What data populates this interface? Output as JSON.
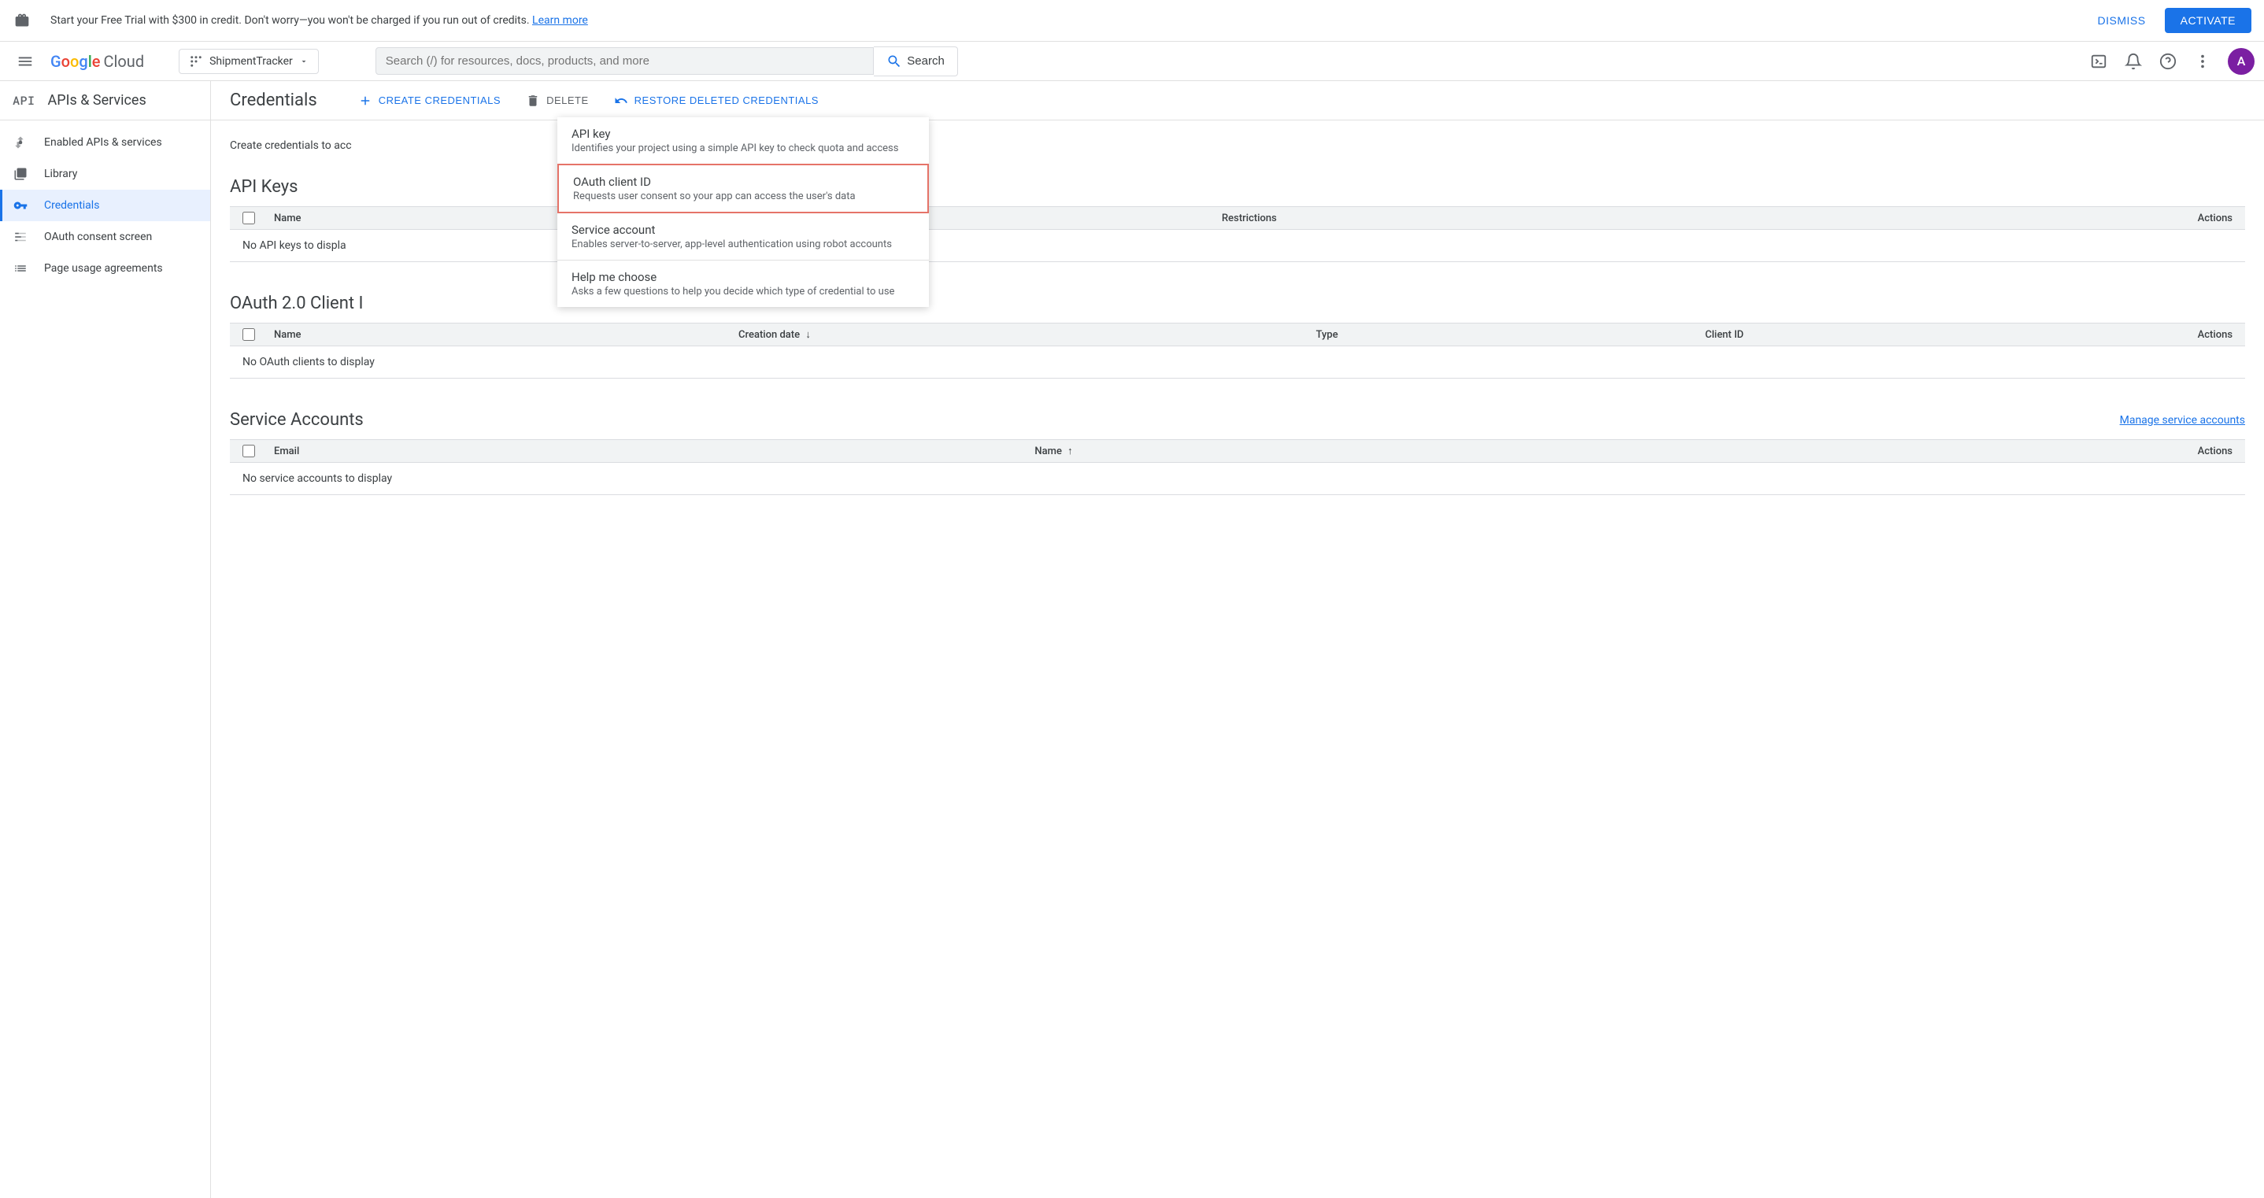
{
  "banner": {
    "text": "Start your Free Trial with $300 in credit. Don't worry—you won't be charged if you run out of credits. ",
    "learn_more": "Learn more",
    "dismiss": "DISMISS",
    "activate": "ACTIVATE"
  },
  "header": {
    "logo_cloud": "Cloud",
    "project_name": "ShipmentTracker",
    "search_placeholder": "Search (/) for resources, docs, products, and more",
    "search_label": "Search",
    "avatar_initial": "A"
  },
  "sidebar": {
    "badge": "API",
    "title": "APIs & Services",
    "items": [
      {
        "label": "Enabled APIs & services"
      },
      {
        "label": "Library"
      },
      {
        "label": "Credentials"
      },
      {
        "label": "OAuth consent screen"
      },
      {
        "label": "Page usage agreements"
      }
    ]
  },
  "page": {
    "title": "Credentials",
    "create": "CREATE CREDENTIALS",
    "delete": "DELETE",
    "restore": "RESTORE DELETED CREDENTIALS",
    "intro": "Create credentials to acc"
  },
  "dropdown": {
    "items": [
      {
        "title": "API key",
        "desc": "Identifies your project using a simple API key to check quota and access"
      },
      {
        "title": "OAuth client ID",
        "desc": "Requests user consent so your app can access the user's data"
      },
      {
        "title": "Service account",
        "desc": "Enables server-to-server, app-level authentication using robot accounts"
      },
      {
        "title": "Help me choose",
        "desc": "Asks a few questions to help you decide which type of credential to use"
      }
    ]
  },
  "sections": {
    "api_keys": {
      "title": "API Keys",
      "cols": {
        "name": "Name",
        "restrictions": "Restrictions",
        "actions": "Actions"
      },
      "empty": "No API keys to displa"
    },
    "oauth": {
      "title": "OAuth 2.0 Client I",
      "cols": {
        "name": "Name",
        "creation": "Creation date",
        "type": "Type",
        "client_id": "Client ID",
        "actions": "Actions"
      },
      "empty": "No OAuth clients to display"
    },
    "service": {
      "title": "Service Accounts",
      "manage": "Manage service accounts",
      "cols": {
        "email": "Email",
        "name": "Name",
        "actions": "Actions"
      },
      "empty": "No service accounts to display"
    }
  }
}
